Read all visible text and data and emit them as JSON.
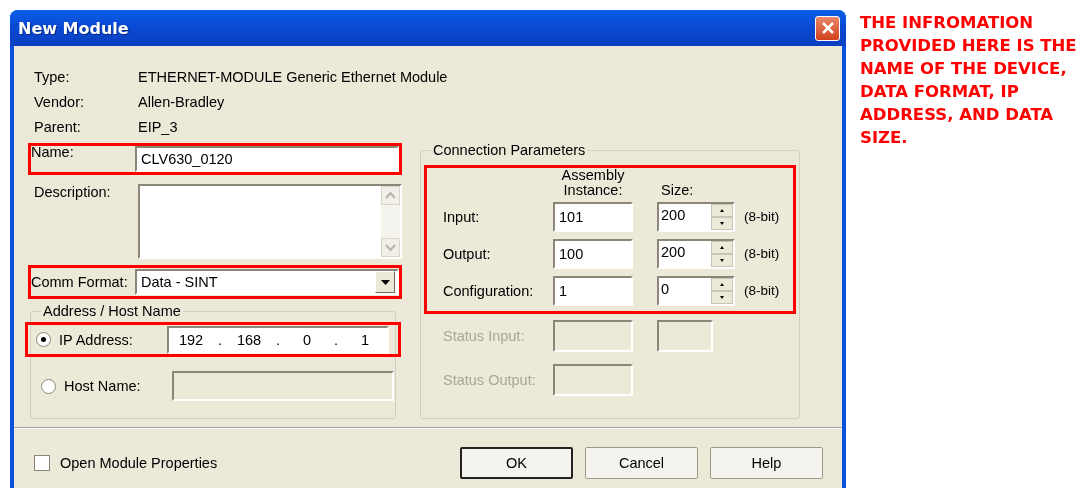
{
  "window": {
    "title": "New Module"
  },
  "info": [
    {
      "label": "Type:",
      "value": "ETHERNET-MODULE Generic Ethernet Module"
    },
    {
      "label": "Vendor:",
      "value": "Allen-Bradley"
    },
    {
      "label": "Parent:",
      "value": "EIP_3"
    }
  ],
  "name": {
    "label": "Name:",
    "value": "CLV630_0120"
  },
  "description": {
    "label": "Description:"
  },
  "comm_format": {
    "label": "Comm Format:",
    "value": "Data - SINT"
  },
  "address": {
    "legend": "Address / Host Name",
    "options": [
      {
        "label": "IP Address:",
        "selected": true,
        "octets": [
          "192",
          "168",
          "0",
          "1"
        ],
        "separator": "."
      },
      {
        "label": "Host Name:",
        "selected": false
      }
    ]
  },
  "connection": {
    "legend": "Connection Parameters",
    "headers": [
      "Assembly Instance:",
      "Size:"
    ],
    "rows": [
      {
        "label": "Input:",
        "instance": "101",
        "size": "200",
        "unit": "(8-bit)",
        "disabled": false
      },
      {
        "label": "Output:",
        "instance": "100",
        "size": "200",
        "unit": "(8-bit)",
        "disabled": false
      },
      {
        "label": "Configuration:",
        "instance": "1",
        "size": "0",
        "unit": "(8-bit)",
        "disabled": false
      },
      {
        "label": "Status Input:",
        "size_field": true,
        "disabled": true
      },
      {
        "label": "Status Output:",
        "size_field": false,
        "disabled": true
      }
    ]
  },
  "open_module_properties": {
    "label": "Open Module Properties",
    "checked": false
  },
  "buttons": [
    {
      "label": "OK",
      "default": true
    },
    {
      "label": "Cancel",
      "default": false
    },
    {
      "label": "Help",
      "default": false
    }
  ],
  "annotation": "THE INFROMATION PROVIDED HERE IS THE NAME OF THE DEVICE, DATA FORMAT, IP ADDRESS, AND DATA SIZE."
}
